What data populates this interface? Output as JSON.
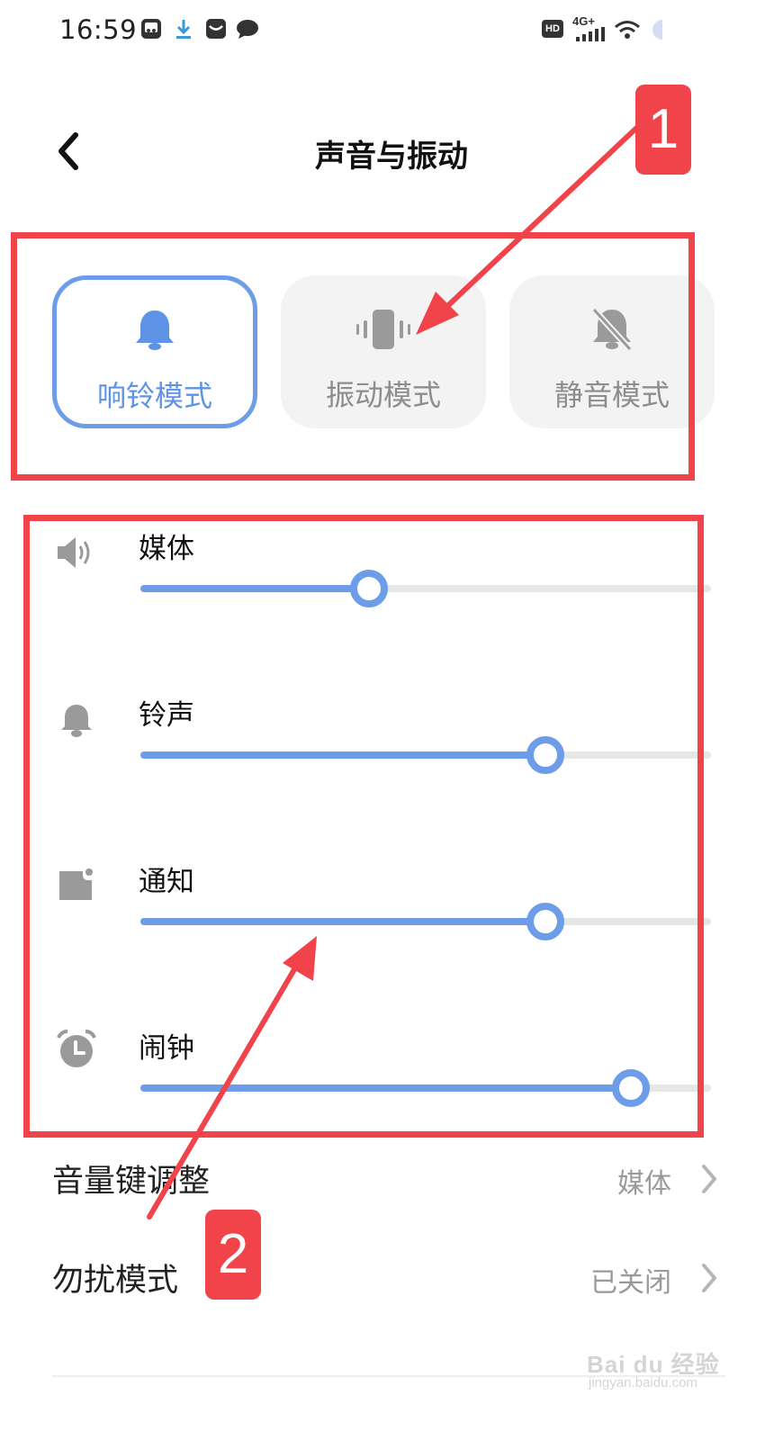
{
  "status_bar": {
    "time": "16:59",
    "left_icons": [
      "screenshot-app-icon",
      "download-icon",
      "mail-icon",
      "chat-icon"
    ],
    "hd_badge": "HD",
    "network": "4G+",
    "right_icons": [
      "signal-icon",
      "wifi-icon",
      "battery-icon"
    ]
  },
  "header": {
    "title": "声音与振动",
    "back_icon": "back-chevron-icon"
  },
  "modes": [
    {
      "label": "响铃模式",
      "icon": "bell-icon",
      "selected": true
    },
    {
      "label": "振动模式",
      "icon": "vibrate-icon",
      "selected": false
    },
    {
      "label": "静音模式",
      "icon": "bell-off-icon",
      "selected": false
    }
  ],
  "volumes": [
    {
      "label": "媒体",
      "icon": "speaker-icon",
      "level": 0.4
    },
    {
      "label": "铃声",
      "icon": "bell-icon",
      "level": 0.71
    },
    {
      "label": "通知",
      "icon": "notification-icon",
      "level": 0.71
    },
    {
      "label": "闹钟",
      "icon": "alarm-clock-icon",
      "level": 0.86
    }
  ],
  "settings": [
    {
      "label": "音量键调整",
      "value": "媒体"
    },
    {
      "label": "勿扰模式",
      "value": "已关闭"
    }
  ],
  "annotations": {
    "badge_1": "1",
    "badge_2": "2"
  },
  "watermark": {
    "main": "Bai du 经验",
    "sub": "jingyan.baidu.com"
  },
  "colors": {
    "accent": "#6d9ce8",
    "annotation": "#f0434a",
    "inactive_icon": "#9a9a9a",
    "track": "#e6e6e6"
  }
}
